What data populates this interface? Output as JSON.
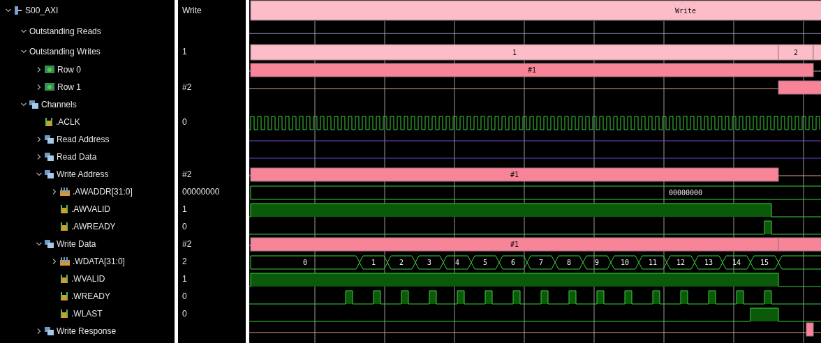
{
  "signals": [
    {
      "name": "S00_AXI",
      "kind": "interface",
      "value": "Write",
      "expanded": true,
      "wave": {
        "kind": "transaction",
        "labels": [
          "Write"
        ]
      },
      "children": [
        {
          "name": "Outstanding Reads",
          "expanded": true,
          "wave": {
            "kind": "line"
          }
        },
        {
          "name": "Outstanding Writes",
          "value": "1",
          "expanded": true,
          "wave": {
            "kind": "count",
            "labels": [
              "1",
              "2"
            ]
          },
          "children": [
            {
              "name": "Row 0",
              "kind": "row",
              "expanded": false,
              "wave": {
                "kind": "slot",
                "labels": [
                  "#1"
                ]
              }
            },
            {
              "name": "Row 1",
              "kind": "row",
              "value": "#2",
              "expanded": false,
              "wave": {
                "kind": "slot"
              }
            }
          ]
        },
        {
          "name": "Channels",
          "kind": "group",
          "expanded": true,
          "children": [
            {
              "name": ".ACLK",
              "kind": "bit",
              "value": "0",
              "wave": {
                "kind": "clock"
              }
            },
            {
              "name": "Read Address",
              "kind": "group",
              "expanded": false,
              "wave": {
                "kind": "line"
              }
            },
            {
              "name": "Read Data",
              "kind": "group",
              "expanded": false,
              "wave": {
                "kind": "line"
              }
            },
            {
              "name": "Write Address",
              "kind": "group",
              "value": "#2",
              "expanded": true,
              "wave": {
                "kind": "slot",
                "labels": [
                  "#1"
                ]
              },
              "children": [
                {
                  "name": ".AWADDR[31:0]",
                  "kind": "bus",
                  "value": "00000000",
                  "expanded": false,
                  "wave": {
                    "kind": "bus",
                    "labels": [
                      "00000000"
                    ]
                  }
                },
                {
                  "name": ".AWVALID",
                  "kind": "bit",
                  "value": "1",
                  "wave": {
                    "kind": "bit"
                  }
                },
                {
                  "name": ".AWREADY",
                  "kind": "bit",
                  "value": "0",
                  "wave": {
                    "kind": "bit"
                  }
                }
              ]
            },
            {
              "name": "Write Data",
              "kind": "group",
              "value": "#2",
              "expanded": true,
              "wave": {
                "kind": "slot",
                "labels": [
                  "#1"
                ]
              },
              "children": [
                {
                  "name": ".WDATA[31:0]",
                  "kind": "bus",
                  "value": "2",
                  "expanded": false,
                  "wave": {
                    "kind": "bus",
                    "labels": [
                      "0",
                      "1",
                      "2",
                      "3",
                      "4",
                      "5",
                      "6",
                      "7",
                      "8",
                      "9",
                      "10",
                      "11",
                      "12",
                      "13",
                      "14",
                      "15"
                    ]
                  }
                },
                {
                  "name": ".WVALID",
                  "kind": "bit",
                  "value": "1",
                  "wave": {
                    "kind": "bit"
                  }
                },
                {
                  "name": ".WREADY",
                  "kind": "bit",
                  "value": "0",
                  "wave": {
                    "kind": "bit"
                  }
                },
                {
                  "name": ".WLAST",
                  "kind": "bit",
                  "value": "0",
                  "wave": {
                    "kind": "bit"
                  }
                }
              ]
            },
            {
              "name": "Write Response",
              "kind": "group",
              "expanded": false,
              "wave": {
                "kind": "slot"
              }
            }
          ]
        }
      ]
    }
  ]
}
